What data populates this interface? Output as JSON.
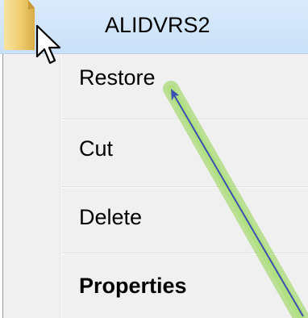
{
  "file": {
    "name": "ALIDVRS2",
    "icon": "folder-icon"
  },
  "context_menu": {
    "items": [
      {
        "label": "Restore",
        "bold": false
      },
      {
        "label": "Cut",
        "bold": false
      },
      {
        "label": "Delete",
        "bold": false
      },
      {
        "label": "Properties",
        "bold": true
      }
    ]
  },
  "annotation": {
    "type": "arrow",
    "target": "Restore",
    "arrow_color": "#3b4fb3",
    "glow_color": "#8fd34a"
  },
  "colors": {
    "selection_bg": "#cfe3f8",
    "menu_bg": "#f0f0f0"
  }
}
